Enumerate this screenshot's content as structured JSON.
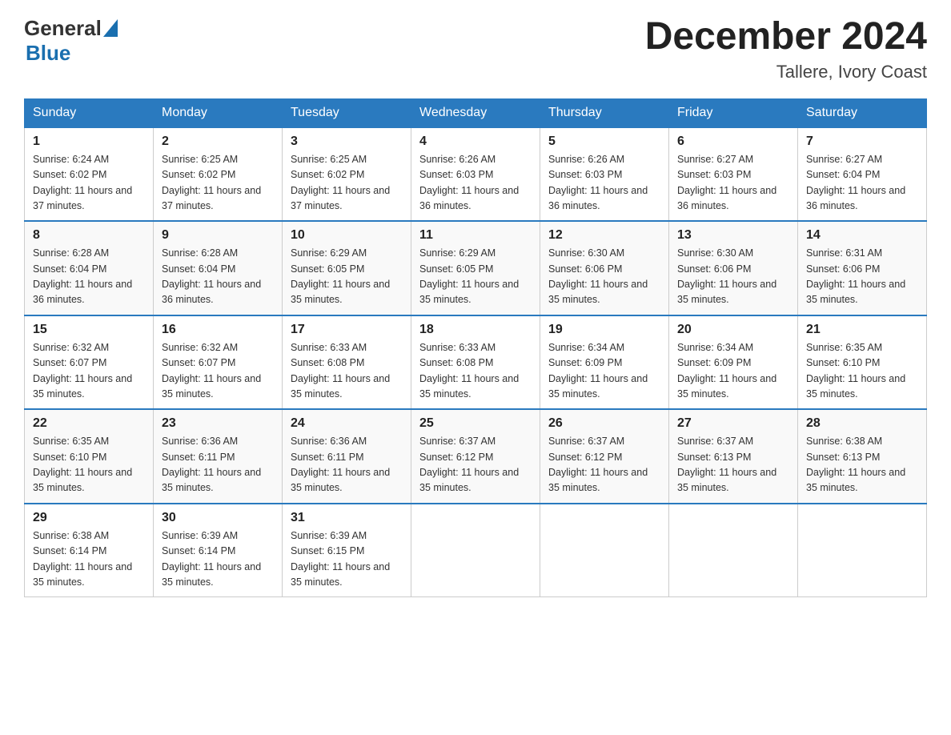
{
  "header": {
    "logo_general": "General",
    "logo_blue": "Blue",
    "month_title": "December 2024",
    "location": "Tallere, Ivory Coast"
  },
  "weekdays": [
    "Sunday",
    "Monday",
    "Tuesday",
    "Wednesday",
    "Thursday",
    "Friday",
    "Saturday"
  ],
  "weeks": [
    [
      {
        "day": "1",
        "sunrise": "6:24 AM",
        "sunset": "6:02 PM",
        "daylight": "11 hours and 37 minutes."
      },
      {
        "day": "2",
        "sunrise": "6:25 AM",
        "sunset": "6:02 PM",
        "daylight": "11 hours and 37 minutes."
      },
      {
        "day": "3",
        "sunrise": "6:25 AM",
        "sunset": "6:02 PM",
        "daylight": "11 hours and 37 minutes."
      },
      {
        "day": "4",
        "sunrise": "6:26 AM",
        "sunset": "6:03 PM",
        "daylight": "11 hours and 36 minutes."
      },
      {
        "day": "5",
        "sunrise": "6:26 AM",
        "sunset": "6:03 PM",
        "daylight": "11 hours and 36 minutes."
      },
      {
        "day": "6",
        "sunrise": "6:27 AM",
        "sunset": "6:03 PM",
        "daylight": "11 hours and 36 minutes."
      },
      {
        "day": "7",
        "sunrise": "6:27 AM",
        "sunset": "6:04 PM",
        "daylight": "11 hours and 36 minutes."
      }
    ],
    [
      {
        "day": "8",
        "sunrise": "6:28 AM",
        "sunset": "6:04 PM",
        "daylight": "11 hours and 36 minutes."
      },
      {
        "day": "9",
        "sunrise": "6:28 AM",
        "sunset": "6:04 PM",
        "daylight": "11 hours and 36 minutes."
      },
      {
        "day": "10",
        "sunrise": "6:29 AM",
        "sunset": "6:05 PM",
        "daylight": "11 hours and 35 minutes."
      },
      {
        "day": "11",
        "sunrise": "6:29 AM",
        "sunset": "6:05 PM",
        "daylight": "11 hours and 35 minutes."
      },
      {
        "day": "12",
        "sunrise": "6:30 AM",
        "sunset": "6:06 PM",
        "daylight": "11 hours and 35 minutes."
      },
      {
        "day": "13",
        "sunrise": "6:30 AM",
        "sunset": "6:06 PM",
        "daylight": "11 hours and 35 minutes."
      },
      {
        "day": "14",
        "sunrise": "6:31 AM",
        "sunset": "6:06 PM",
        "daylight": "11 hours and 35 minutes."
      }
    ],
    [
      {
        "day": "15",
        "sunrise": "6:32 AM",
        "sunset": "6:07 PM",
        "daylight": "11 hours and 35 minutes."
      },
      {
        "day": "16",
        "sunrise": "6:32 AM",
        "sunset": "6:07 PM",
        "daylight": "11 hours and 35 minutes."
      },
      {
        "day": "17",
        "sunrise": "6:33 AM",
        "sunset": "6:08 PM",
        "daylight": "11 hours and 35 minutes."
      },
      {
        "day": "18",
        "sunrise": "6:33 AM",
        "sunset": "6:08 PM",
        "daylight": "11 hours and 35 minutes."
      },
      {
        "day": "19",
        "sunrise": "6:34 AM",
        "sunset": "6:09 PM",
        "daylight": "11 hours and 35 minutes."
      },
      {
        "day": "20",
        "sunrise": "6:34 AM",
        "sunset": "6:09 PM",
        "daylight": "11 hours and 35 minutes."
      },
      {
        "day": "21",
        "sunrise": "6:35 AM",
        "sunset": "6:10 PM",
        "daylight": "11 hours and 35 minutes."
      }
    ],
    [
      {
        "day": "22",
        "sunrise": "6:35 AM",
        "sunset": "6:10 PM",
        "daylight": "11 hours and 35 minutes."
      },
      {
        "day": "23",
        "sunrise": "6:36 AM",
        "sunset": "6:11 PM",
        "daylight": "11 hours and 35 minutes."
      },
      {
        "day": "24",
        "sunrise": "6:36 AM",
        "sunset": "6:11 PM",
        "daylight": "11 hours and 35 minutes."
      },
      {
        "day": "25",
        "sunrise": "6:37 AM",
        "sunset": "6:12 PM",
        "daylight": "11 hours and 35 minutes."
      },
      {
        "day": "26",
        "sunrise": "6:37 AM",
        "sunset": "6:12 PM",
        "daylight": "11 hours and 35 minutes."
      },
      {
        "day": "27",
        "sunrise": "6:37 AM",
        "sunset": "6:13 PM",
        "daylight": "11 hours and 35 minutes."
      },
      {
        "day": "28",
        "sunrise": "6:38 AM",
        "sunset": "6:13 PM",
        "daylight": "11 hours and 35 minutes."
      }
    ],
    [
      {
        "day": "29",
        "sunrise": "6:38 AM",
        "sunset": "6:14 PM",
        "daylight": "11 hours and 35 minutes."
      },
      {
        "day": "30",
        "sunrise": "6:39 AM",
        "sunset": "6:14 PM",
        "daylight": "11 hours and 35 minutes."
      },
      {
        "day": "31",
        "sunrise": "6:39 AM",
        "sunset": "6:15 PM",
        "daylight": "11 hours and 35 minutes."
      },
      null,
      null,
      null,
      null
    ]
  ]
}
